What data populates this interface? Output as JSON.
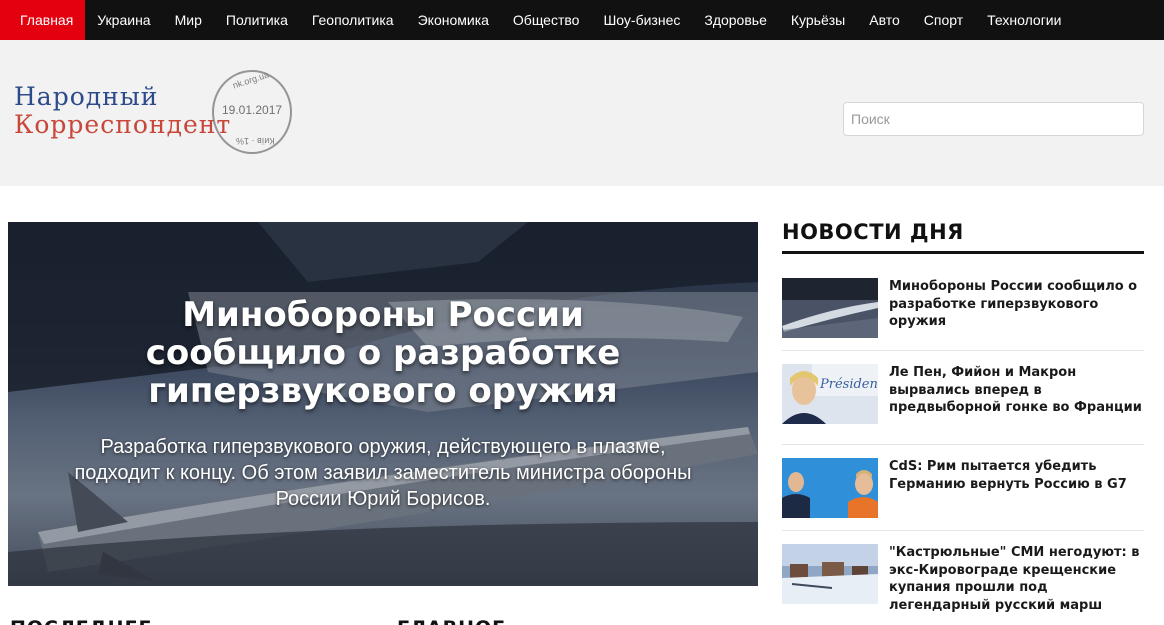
{
  "nav": {
    "items": [
      {
        "label": "Главная",
        "active": true
      },
      {
        "label": "Украина"
      },
      {
        "label": "Мир"
      },
      {
        "label": "Политика"
      },
      {
        "label": "Геополитика"
      },
      {
        "label": "Экономика"
      },
      {
        "label": "Общество"
      },
      {
        "label": "Шоу-бизнес"
      },
      {
        "label": "Здоровье"
      },
      {
        "label": "Курьёзы"
      },
      {
        "label": "Авто"
      },
      {
        "label": "Спорт"
      },
      {
        "label": "Технологии"
      }
    ]
  },
  "logo": {
    "line1": "Народный",
    "line2": "Корреспондент",
    "stamp_top": "nk.org.ua",
    "stamp_date": "19.01.2017",
    "stamp_bottom": "Київ · 1%"
  },
  "search": {
    "placeholder": "Поиск"
  },
  "hero": {
    "title": "Минобороны России сообщило о разработке гиперзвукового оружия",
    "lead": "Разработка гиперзвукового оружия, действующего в плазме, подходит к концу. Об этом заявил заместитель министра обороны России Юрий Борисов."
  },
  "sidebar": {
    "title": "НОВОСТИ ДНЯ",
    "items": [
      {
        "title": "Минобороны России сообщило о разработке гиперзвукового оружия",
        "thumb": "missile-photo"
      },
      {
        "title": "Ле Пен, Фийон и Макрон вырвались вперед в предвыборной гонке во Франции",
        "thumb": "le-pen-photo",
        "thumb_text": "Présidente"
      },
      {
        "title": "CdS: Рим пытается убедить Германию вернуть Россию в G7",
        "thumb": "leaders-photo"
      },
      {
        "title": "\"Кастрюльные\" СМИ негодуют: в экс-Кировограде крещенские купания прошли под легендарный русский марш",
        "thumb": "winter-town-photo"
      }
    ]
  },
  "bottom": {
    "left": "ПОСЛЕДНЕЕ",
    "right": "ГЛАВНОЕ"
  },
  "colors": {
    "nav_bg": "#111111",
    "nav_active": "#e3000f",
    "header_bg": "#f2f2f2",
    "logo_blue": "#2d4a8a",
    "logo_red": "#c8463a"
  }
}
